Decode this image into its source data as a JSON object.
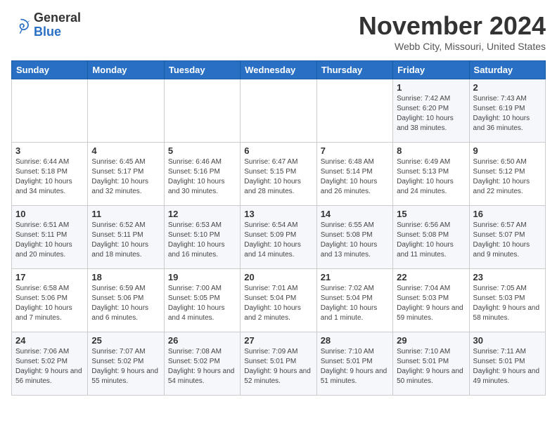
{
  "logo": {
    "general": "General",
    "blue": "Blue"
  },
  "title": "November 2024",
  "location": "Webb City, Missouri, United States",
  "days_of_week": [
    "Sunday",
    "Monday",
    "Tuesday",
    "Wednesday",
    "Thursday",
    "Friday",
    "Saturday"
  ],
  "weeks": [
    [
      {
        "day": "",
        "info": ""
      },
      {
        "day": "",
        "info": ""
      },
      {
        "day": "",
        "info": ""
      },
      {
        "day": "",
        "info": ""
      },
      {
        "day": "",
        "info": ""
      },
      {
        "day": "1",
        "info": "Sunrise: 7:42 AM\nSunset: 6:20 PM\nDaylight: 10 hours and 38 minutes."
      },
      {
        "day": "2",
        "info": "Sunrise: 7:43 AM\nSunset: 6:19 PM\nDaylight: 10 hours and 36 minutes."
      }
    ],
    [
      {
        "day": "3",
        "info": "Sunrise: 6:44 AM\nSunset: 5:18 PM\nDaylight: 10 hours and 34 minutes."
      },
      {
        "day": "4",
        "info": "Sunrise: 6:45 AM\nSunset: 5:17 PM\nDaylight: 10 hours and 32 minutes."
      },
      {
        "day": "5",
        "info": "Sunrise: 6:46 AM\nSunset: 5:16 PM\nDaylight: 10 hours and 30 minutes."
      },
      {
        "day": "6",
        "info": "Sunrise: 6:47 AM\nSunset: 5:15 PM\nDaylight: 10 hours and 28 minutes."
      },
      {
        "day": "7",
        "info": "Sunrise: 6:48 AM\nSunset: 5:14 PM\nDaylight: 10 hours and 26 minutes."
      },
      {
        "day": "8",
        "info": "Sunrise: 6:49 AM\nSunset: 5:13 PM\nDaylight: 10 hours and 24 minutes."
      },
      {
        "day": "9",
        "info": "Sunrise: 6:50 AM\nSunset: 5:12 PM\nDaylight: 10 hours and 22 minutes."
      }
    ],
    [
      {
        "day": "10",
        "info": "Sunrise: 6:51 AM\nSunset: 5:11 PM\nDaylight: 10 hours and 20 minutes."
      },
      {
        "day": "11",
        "info": "Sunrise: 6:52 AM\nSunset: 5:11 PM\nDaylight: 10 hours and 18 minutes."
      },
      {
        "day": "12",
        "info": "Sunrise: 6:53 AM\nSunset: 5:10 PM\nDaylight: 10 hours and 16 minutes."
      },
      {
        "day": "13",
        "info": "Sunrise: 6:54 AM\nSunset: 5:09 PM\nDaylight: 10 hours and 14 minutes."
      },
      {
        "day": "14",
        "info": "Sunrise: 6:55 AM\nSunset: 5:08 PM\nDaylight: 10 hours and 13 minutes."
      },
      {
        "day": "15",
        "info": "Sunrise: 6:56 AM\nSunset: 5:08 PM\nDaylight: 10 hours and 11 minutes."
      },
      {
        "day": "16",
        "info": "Sunrise: 6:57 AM\nSunset: 5:07 PM\nDaylight: 10 hours and 9 minutes."
      }
    ],
    [
      {
        "day": "17",
        "info": "Sunrise: 6:58 AM\nSunset: 5:06 PM\nDaylight: 10 hours and 7 minutes."
      },
      {
        "day": "18",
        "info": "Sunrise: 6:59 AM\nSunset: 5:06 PM\nDaylight: 10 hours and 6 minutes."
      },
      {
        "day": "19",
        "info": "Sunrise: 7:00 AM\nSunset: 5:05 PM\nDaylight: 10 hours and 4 minutes."
      },
      {
        "day": "20",
        "info": "Sunrise: 7:01 AM\nSunset: 5:04 PM\nDaylight: 10 hours and 2 minutes."
      },
      {
        "day": "21",
        "info": "Sunrise: 7:02 AM\nSunset: 5:04 PM\nDaylight: 10 hours and 1 minute."
      },
      {
        "day": "22",
        "info": "Sunrise: 7:04 AM\nSunset: 5:03 PM\nDaylight: 9 hours and 59 minutes."
      },
      {
        "day": "23",
        "info": "Sunrise: 7:05 AM\nSunset: 5:03 PM\nDaylight: 9 hours and 58 minutes."
      }
    ],
    [
      {
        "day": "24",
        "info": "Sunrise: 7:06 AM\nSunset: 5:02 PM\nDaylight: 9 hours and 56 minutes."
      },
      {
        "day": "25",
        "info": "Sunrise: 7:07 AM\nSunset: 5:02 PM\nDaylight: 9 hours and 55 minutes."
      },
      {
        "day": "26",
        "info": "Sunrise: 7:08 AM\nSunset: 5:02 PM\nDaylight: 9 hours and 54 minutes."
      },
      {
        "day": "27",
        "info": "Sunrise: 7:09 AM\nSunset: 5:01 PM\nDaylight: 9 hours and 52 minutes."
      },
      {
        "day": "28",
        "info": "Sunrise: 7:10 AM\nSunset: 5:01 PM\nDaylight: 9 hours and 51 minutes."
      },
      {
        "day": "29",
        "info": "Sunrise: 7:10 AM\nSunset: 5:01 PM\nDaylight: 9 hours and 50 minutes."
      },
      {
        "day": "30",
        "info": "Sunrise: 7:11 AM\nSunset: 5:01 PM\nDaylight: 9 hours and 49 minutes."
      }
    ]
  ]
}
